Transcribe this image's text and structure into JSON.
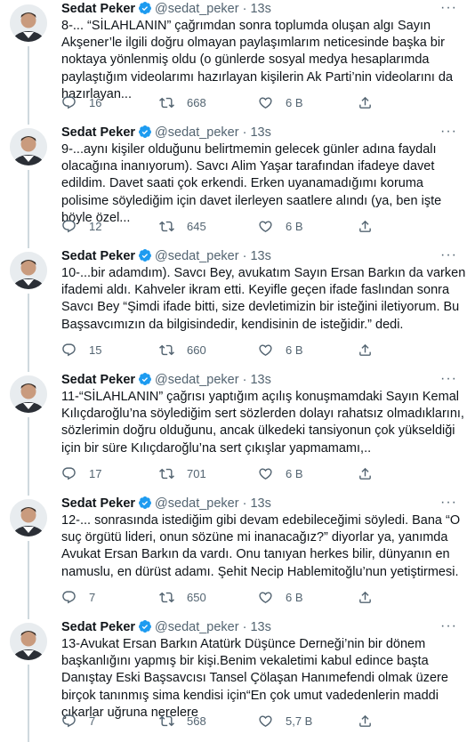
{
  "tweets": [
    {
      "name": "Sedat Peker",
      "handle": "@sedat_peker",
      "sep": "·",
      "time": "13s",
      "text": "8-... “SİLAHLANIN” çağrımdan sonra toplumda oluşan algı Sayın Akşener’le ilgili doğru olmayan paylaşımlarım neticesinde başka bir noktaya yönlenmiş oldu (o günlerde sosyal medya hesaplarımda paylaştığım videolarımı hazırlayan kişilerin Ak Parti’nin videolarını da hazırlayan...",
      "replies": "16",
      "retweets": "668",
      "likes": "6 B"
    },
    {
      "name": "Sedat Peker",
      "handle": "@sedat_peker",
      "sep": "·",
      "time": "13s",
      "text": "9-...aynı kişiler olduğunu belirtmemin gelecek günler adına faydalı olacağına inanıyorum). Savcı Alim Yaşar tarafından ifadeye davet edildim. Davet saati çok erkendi. Erken uyanamadığımı koruma polisime söylediğim için davet ilerleyen saatlere alındı (ya, ben işte böyle özel...",
      "replies": "12",
      "retweets": "645",
      "likes": "6 B"
    },
    {
      "name": "Sedat Peker",
      "handle": "@sedat_peker",
      "sep": "·",
      "time": "13s",
      "text": "10-...bir adamdım). Savcı Bey, avukatım Sayın Ersan Barkın da varken ifademi aldı. Kahveler ikram etti. Keyifle geçen ifade faslından sonra Savcı Bey “Şimdi ifade bitti, size devletimizin bir isteğini iletiyorum. Bu Başsavcımızın da bilgisindedir, kendisinin de isteğidir.” dedi.",
      "replies": "15",
      "retweets": "660",
      "likes": "6 B"
    },
    {
      "name": "Sedat Peker",
      "handle": "@sedat_peker",
      "sep": "·",
      "time": "13s",
      "text": "11-“SİLAHLANIN” çağrısı yaptığım açılış konuşmamdaki Sayın Kemal Kılıçdaroğlu’na söylediğim sert sözlerden dolayı rahatsız olmadıklarını, sözlerimin doğru olduğunu, ancak ülkedeki tansiyonun çok yükseldiği için bir süre Kılıçdaroğlu’na sert çıkışlar yapmamamı,..",
      "replies": "17",
      "retweets": "701",
      "likes": "6 B"
    },
    {
      "name": "Sedat Peker",
      "handle": "@sedat_peker",
      "sep": "·",
      "time": "13s",
      "text": "12-... sonrasında istediğim gibi devam edebileceğimi söyledi. Bana “O suç örgütü lideri, onun sözüne mi inanacağız?” diyorlar ya, yanımda Avukat Ersan Barkın da vardı. Onu tanıyan herkes bilir, dünyanın en namuslu, en dürüst adamı. Şehit Necip Hablemitoğlu’nun yetiştirmesi.",
      "replies": "7",
      "retweets": "650",
      "likes": "6 B"
    },
    {
      "name": "Sedat Peker",
      "handle": "@sedat_peker",
      "sep": "·",
      "time": "13s",
      "text": "13-Avukat Ersan Barkın Atatürk Düşünce Derneği’nin bir dönem başkanlığını yapmış bir kişi.Benim vekaletimi kabul edince başta Danıştay Eski Başsavcısı Tansel Çölaşan Hanımefendi olmak üzere birçok tanınmış sima kendisi için“En çok umut vadedenlerin maddi çıkarlar uğruna nerelere",
      "replies": "7",
      "retweets": "568",
      "likes": "5,7 B"
    }
  ],
  "icons": {
    "verified": "verified-badge-icon",
    "more": "more-dots-icon",
    "reply": "reply-icon",
    "retweet": "retweet-icon",
    "like": "heart-icon",
    "share": "share-icon"
  },
  "colors": {
    "verified": "#1d9bf0",
    "text": "#0f1419",
    "muted": "#536471",
    "thread_line": "#cfd9de"
  }
}
